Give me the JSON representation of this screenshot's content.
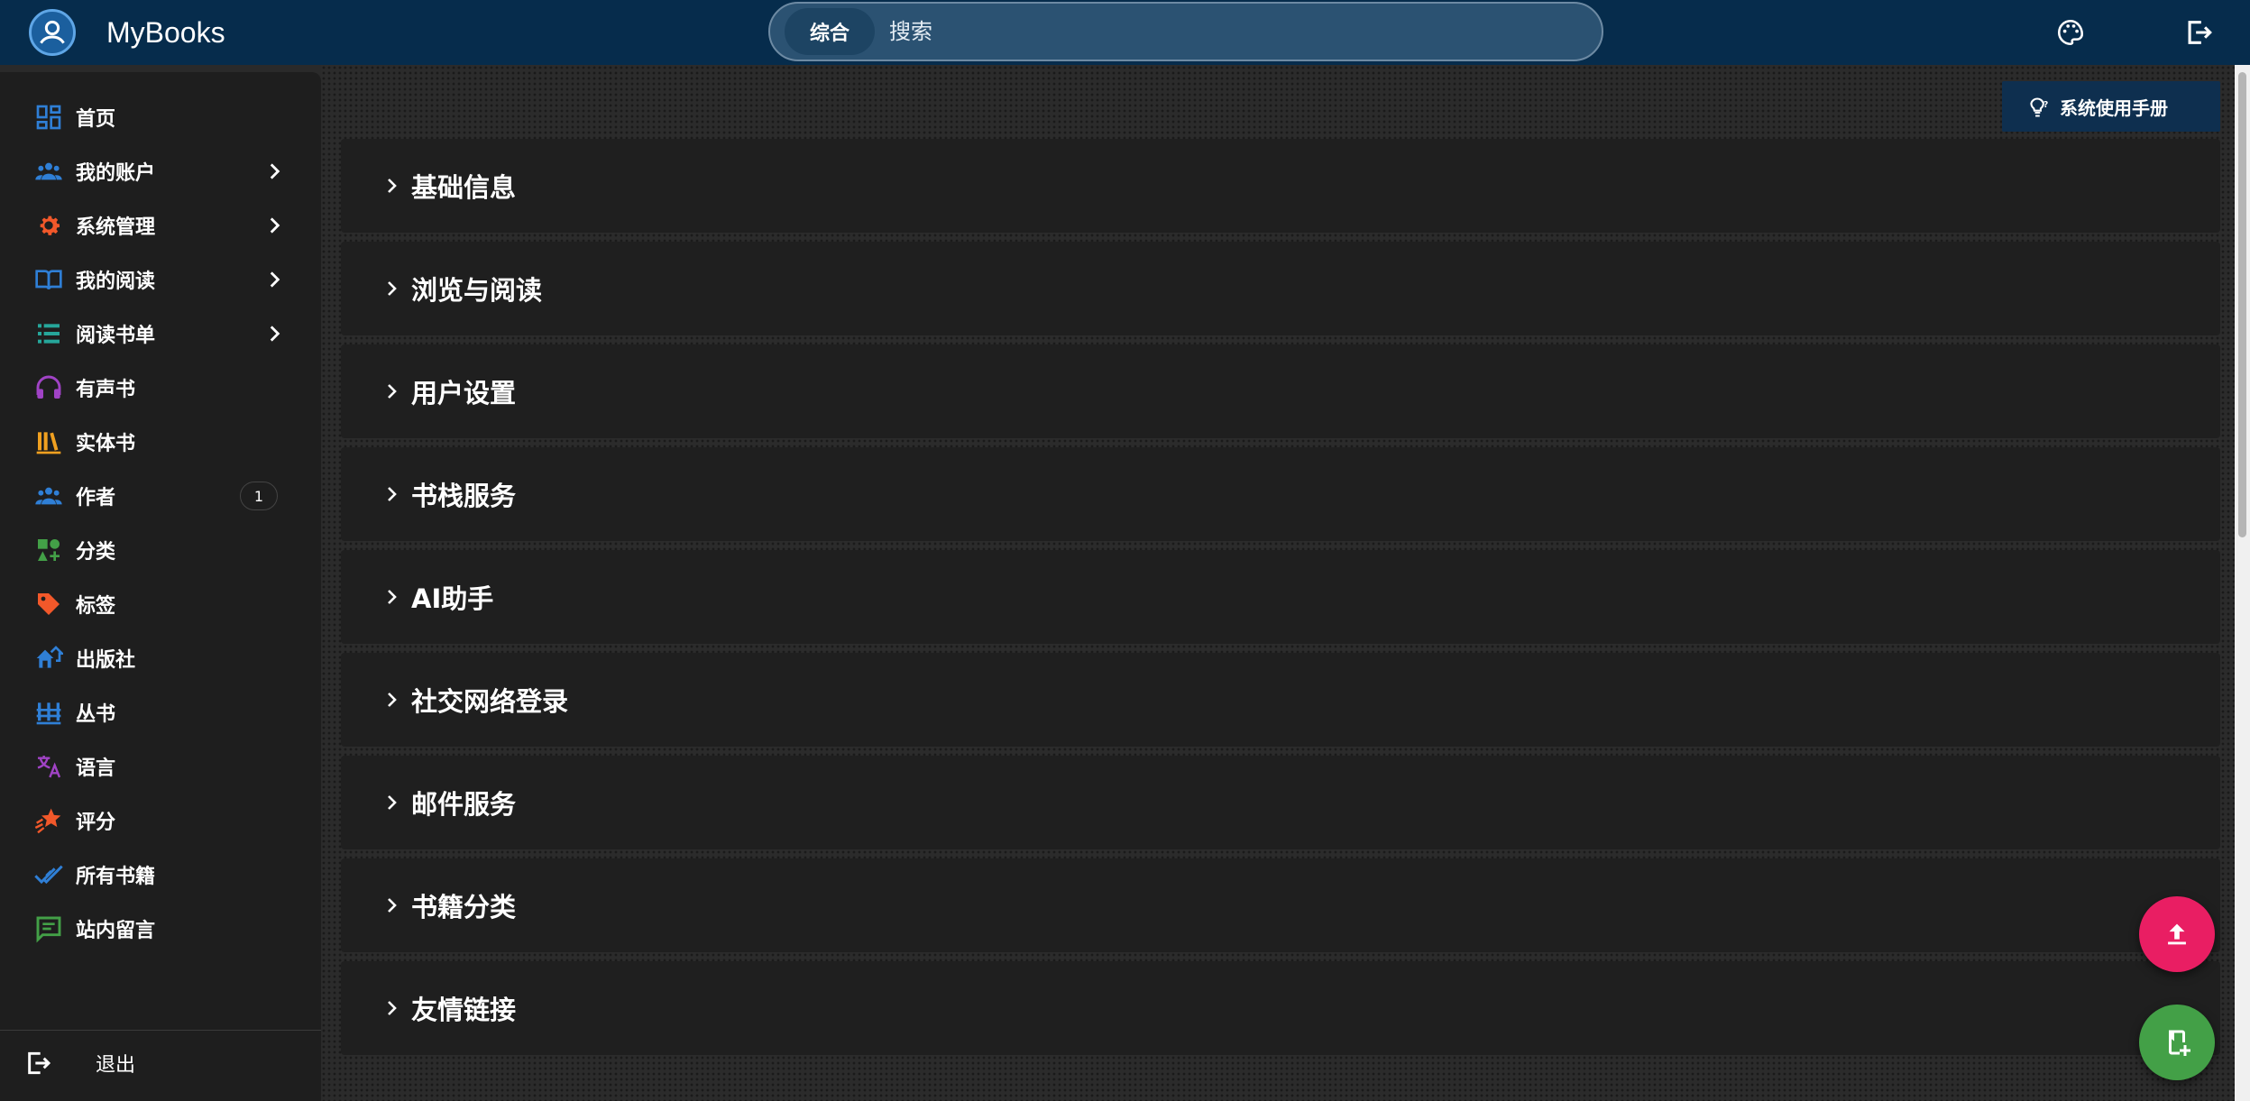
{
  "header": {
    "app_title": "MyBooks",
    "search_tab_label": "综合",
    "search_placeholder": "搜索",
    "icons": [
      "account-circle-icon",
      "palette-icon",
      "logout-icon"
    ]
  },
  "sidebar": {
    "items": [
      {
        "label": "首页",
        "icon": "dashboard-icon",
        "color": "#2f7fd6",
        "chevron": false
      },
      {
        "label": "我的账户",
        "icon": "people-icon",
        "color": "#2f7fd6",
        "chevron": true
      },
      {
        "label": "系统管理",
        "icon": "gear-icon",
        "color": "#f2582a",
        "chevron": true
      },
      {
        "label": "我的阅读",
        "icon": "open-book-icon",
        "color": "#2f7fd6",
        "chevron": true
      },
      {
        "label": "阅读书单",
        "icon": "list-icon",
        "color": "#26a69a",
        "chevron": true
      },
      {
        "label": "有声书",
        "icon": "headphones-icon",
        "color": "#a043c5",
        "chevron": false
      },
      {
        "label": "实体书",
        "icon": "bookshelf-icon",
        "color": "#f0a020",
        "chevron": false
      },
      {
        "label": "作者",
        "icon": "people-icon",
        "color": "#2f7fd6",
        "chevron": false,
        "badge": "1"
      },
      {
        "label": "分类",
        "icon": "category-icon",
        "color": "#43a047",
        "chevron": false
      },
      {
        "label": "标签",
        "icon": "tag-icon",
        "color": "#f2582a",
        "chevron": false
      },
      {
        "label": "出版社",
        "icon": "house-icon",
        "color": "#2f7fd6",
        "chevron": false
      },
      {
        "label": "丛书",
        "icon": "columns-icon",
        "color": "#2f7fd6",
        "chevron": false
      },
      {
        "label": "语言",
        "icon": "translate-icon",
        "color": "#a043c5",
        "chevron": false
      },
      {
        "label": "评分",
        "icon": "star-icon",
        "color": "#f2582a",
        "chevron": false
      },
      {
        "label": "所有书籍",
        "icon": "done-all-icon",
        "color": "#2f7fd6",
        "chevron": false
      },
      {
        "label": "站内留言",
        "icon": "message-icon",
        "color": "#43a047",
        "chevron": false
      }
    ],
    "logout_label": "退出"
  },
  "main": {
    "manual_button_label": "系统使用手册",
    "panels": [
      {
        "title": "基础信息"
      },
      {
        "title": "浏览与阅读"
      },
      {
        "title": "用户设置"
      },
      {
        "title": "书栈服务"
      },
      {
        "title": "AI助手"
      },
      {
        "title": "社交网络登录"
      },
      {
        "title": "邮件服务"
      },
      {
        "title": "书籍分类"
      },
      {
        "title": "友情链接"
      }
    ]
  },
  "colors": {
    "header_bg": "#062c4c",
    "sidebar_bg": "#1e1e1e",
    "panel_bg": "#1f1f1f",
    "fab_upload": "#e91e63",
    "fab_add": "#43a047"
  }
}
